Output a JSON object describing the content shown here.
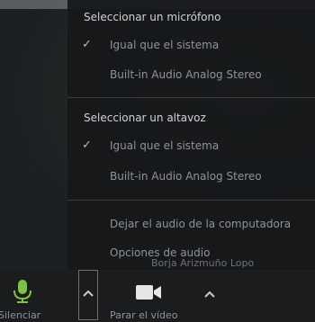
{
  "menu": {
    "microphone_title": "Seleccionar un micrófono",
    "microphone_options": [
      {
        "label": "Igual que el sistema",
        "checked": true
      },
      {
        "label": "Built-in Audio Analog Stereo",
        "checked": false
      }
    ],
    "speaker_title": "Seleccionar un altavoz",
    "speaker_options": [
      {
        "label": "Igual que el sistema",
        "checked": true
      },
      {
        "label": "Built-in Audio Analog Stereo",
        "checked": false
      }
    ],
    "leave_audio": "Dejar el audio de la computadora",
    "audio_options": "Opciones de audio",
    "check_glyph": "✓"
  },
  "participant_name": "Borja Arizmuño Lopo",
  "toolbar": {
    "mute_label": "Silenciar",
    "stop_video_label": "Parar el vídeo",
    "accent_color": "#7dc243"
  }
}
